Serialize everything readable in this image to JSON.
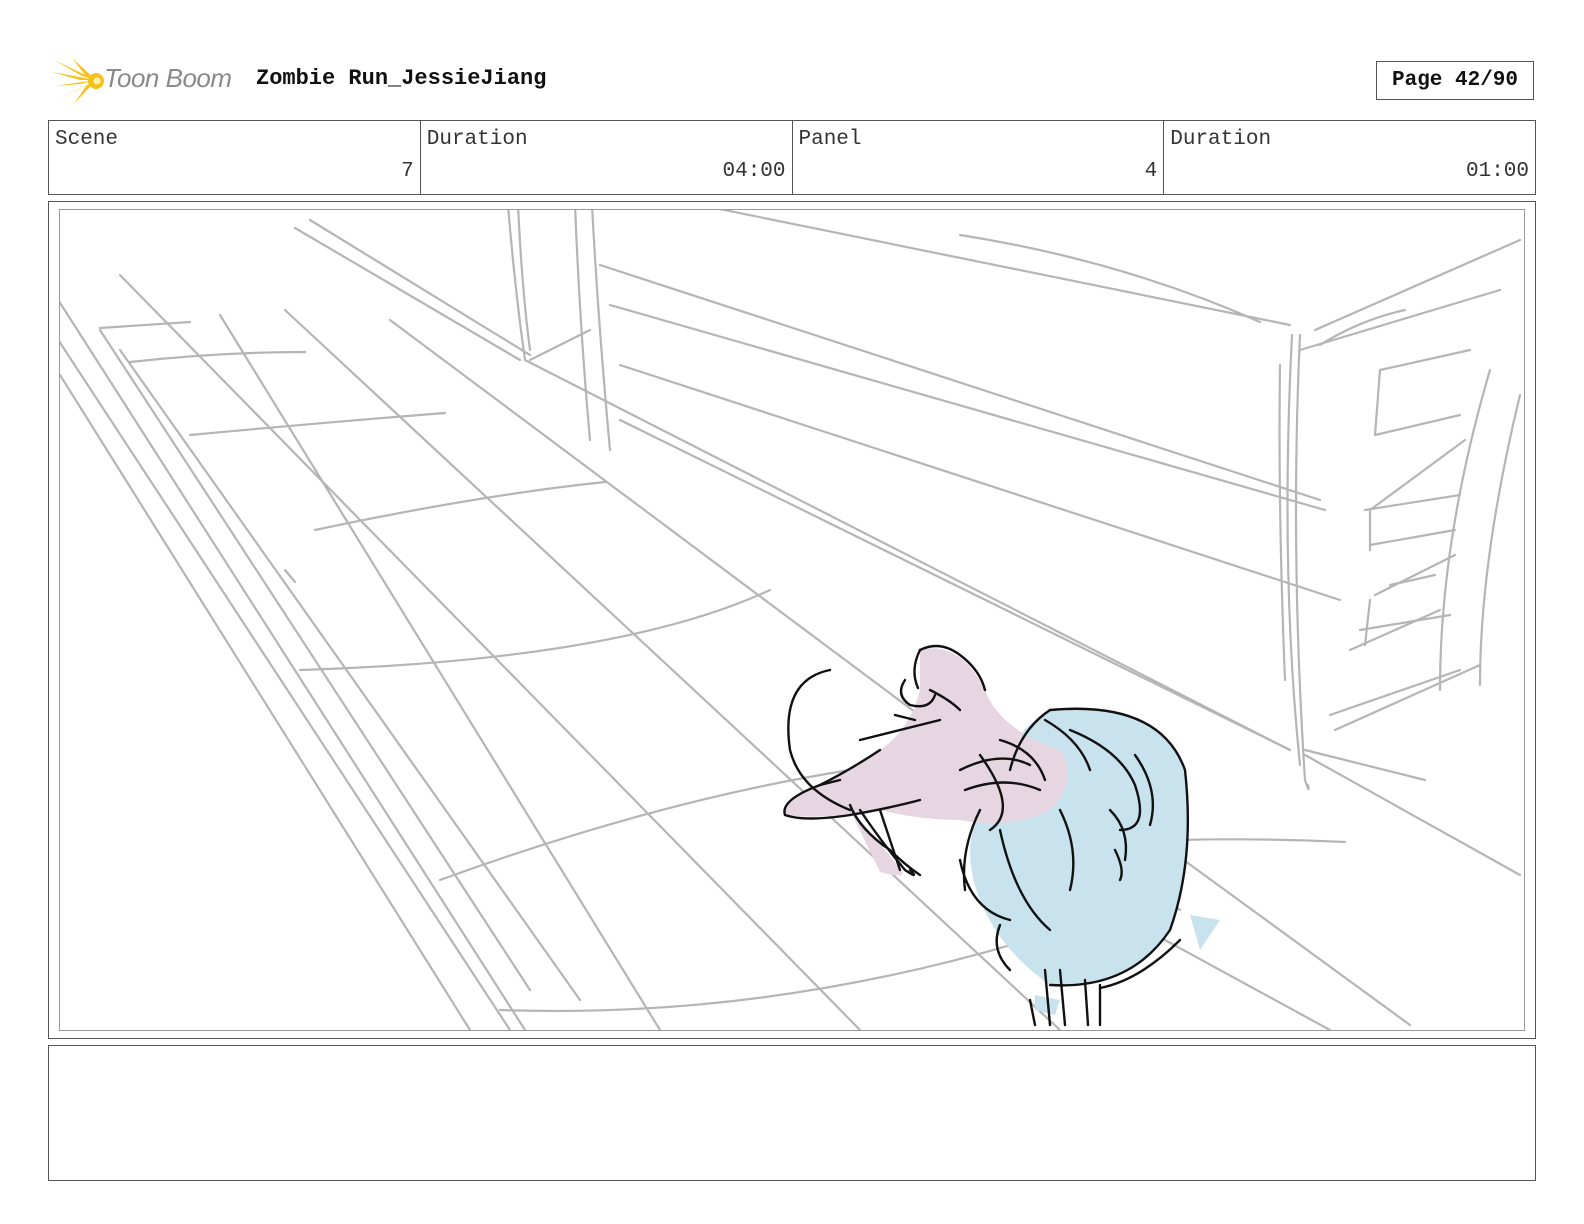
{
  "header": {
    "logo_text": "Toon Boom",
    "title": "Zombie Run_JessieJiang",
    "page_label": "Page 42/90"
  },
  "info": {
    "scene_label": "Scene",
    "scene_value": "7",
    "scene_duration_label": "Duration",
    "scene_duration_value": "04:00",
    "panel_label": "Panel",
    "panel_value": "4",
    "panel_duration_label": "Duration",
    "panel_duration_value": "01:00"
  },
  "panel": {
    "drawing": "storyboard-sketch",
    "colors": {
      "sketch_line": "#b5b5b5",
      "ink": "#111111",
      "jacket": "#c8e2ee",
      "skin": "#e6d6e2",
      "logo_yellow": "#f6c21a"
    }
  },
  "notes": {
    "text": ""
  }
}
